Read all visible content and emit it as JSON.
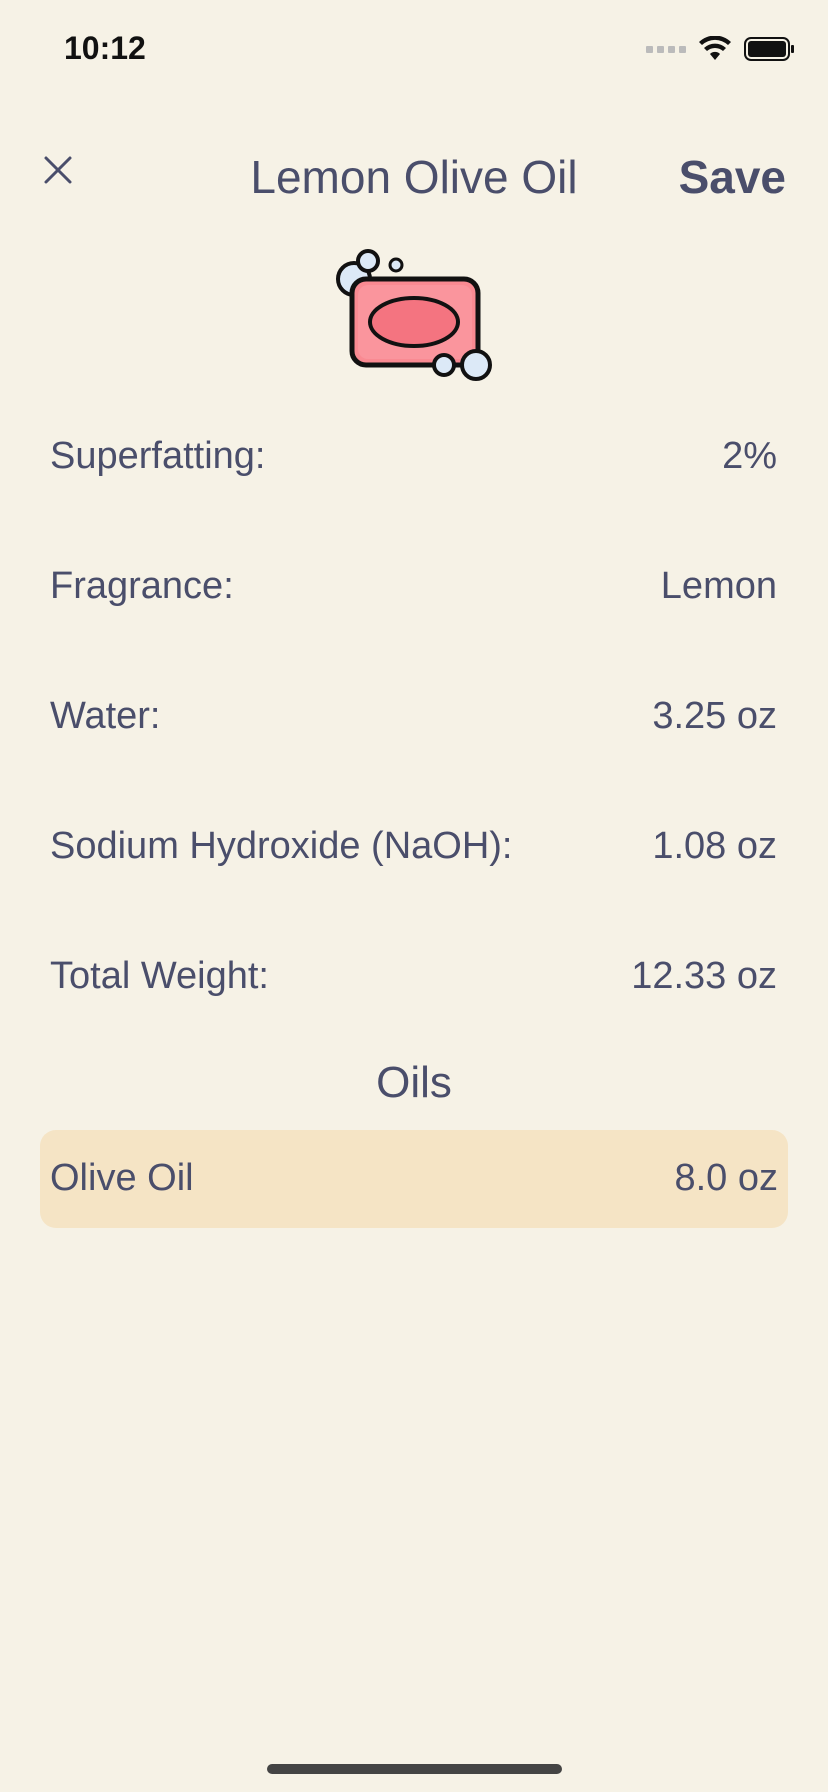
{
  "status_bar": {
    "time": "10:12"
  },
  "header": {
    "title": "Lemon Olive Oil",
    "save_label": "Save"
  },
  "details": [
    {
      "label": "Superfatting:",
      "value": "2%"
    },
    {
      "label": "Fragrance:",
      "value": "Lemon"
    },
    {
      "label": "Water:",
      "value": "3.25 oz"
    },
    {
      "label": "Sodium Hydroxide (NaOH):",
      "value": "1.08 oz"
    },
    {
      "label": "Total Weight:",
      "value": "12.33 oz"
    }
  ],
  "oils_section": {
    "title": "Oils",
    "items": [
      {
        "name": "Olive Oil",
        "amount": "8.0 oz"
      }
    ]
  },
  "colors": {
    "background": "#F6F2E6",
    "text": "#4A4E6B",
    "oil_row_bg": "#F5E4C5",
    "soap_fill": "#F98A92"
  }
}
